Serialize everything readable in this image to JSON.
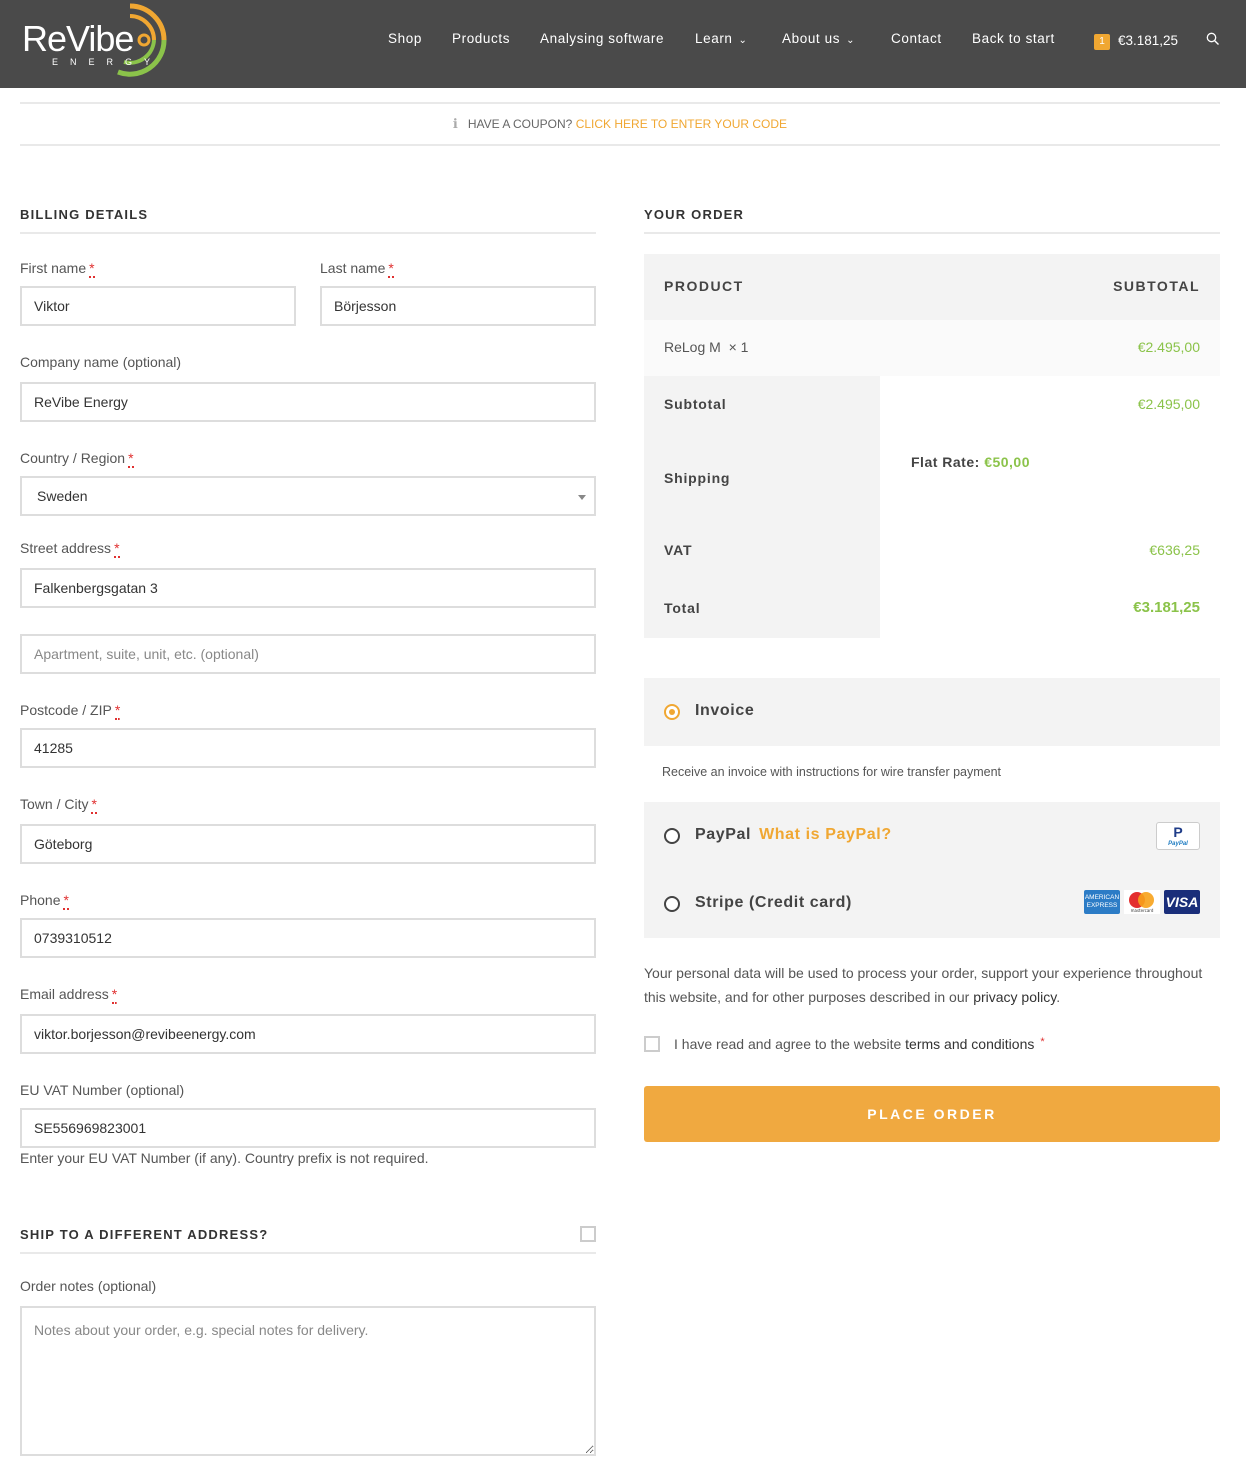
{
  "header": {
    "logo_text": "ReVibe",
    "logo_sub": "ENERGY",
    "nav": [
      "Shop",
      "Products",
      "Analysing software",
      "Learn",
      "About us",
      "Contact",
      "Back to start"
    ],
    "cart_count": "1",
    "cart_total": "€3.181,25"
  },
  "coupon": {
    "text": "Have a coupon?",
    "link": "Click here to enter your code"
  },
  "billing": {
    "title": "Billing details",
    "first_name_label": "First name",
    "first_name": "Viktor",
    "last_name_label": "Last name",
    "last_name": "Börjesson",
    "company_label": "Company name (optional)",
    "company": "ReVibe Energy",
    "country_label": "Country / Region",
    "country": "Sweden",
    "street_label": "Street address",
    "street": "Falkenbergsgatan 3",
    "apartment_placeholder": "Apartment, suite, unit, etc. (optional)",
    "postcode_label": "Postcode / ZIP",
    "postcode": "41285",
    "city_label": "Town / City",
    "city": "Göteborg",
    "phone_label": "Phone",
    "phone": "0739310512",
    "email_label": "Email address",
    "email": "viktor.borjesson@revibeenergy.com",
    "vat_label": "EU VAT Number (optional)",
    "vat": "SE556969823001",
    "vat_hint": "Enter your EU VAT Number (if any). Country prefix is not required.",
    "required_mark": "*"
  },
  "shipping": {
    "title": "Ship to a different address?",
    "notes_label": "Order notes (optional)",
    "notes_placeholder": "Notes about your order, e.g. special notes for delivery."
  },
  "order": {
    "title": "Your order",
    "col_product": "PRODUCT",
    "col_subtotal": "SUBTOTAL",
    "item_name": "ReLog M",
    "item_qty": "× 1",
    "item_price": "€2.495,00",
    "subtotal_label": "Subtotal",
    "subtotal": "€2.495,00",
    "shipping_label": "Shipping",
    "flat_rate_label": "Flat Rate:",
    "flat_rate": "€50,00",
    "vat_label": "VAT",
    "vat": "€636,25",
    "total_label": "Total",
    "total": "€3.181,25"
  },
  "payment": {
    "invoice_label": "Invoice",
    "invoice_desc": "Receive an invoice with instructions for wire transfer payment",
    "paypal_label": "PayPal",
    "paypal_link": "What is PayPal?",
    "paypal_badge": "P",
    "paypal_badge_sub": "PayPal",
    "stripe_label": "Stripe (Credit card)",
    "amex_text": "AMERICAN EXPRESS",
    "mc_text": "mastercard",
    "visa_text": "VISA"
  },
  "privacy": {
    "text": "Your personal data will be used to process your order, support your experience throughout this website, and for other purposes described in our ",
    "link": "privacy policy",
    "end": "."
  },
  "terms": {
    "text": "I have read and agree to the website ",
    "link": "terms and conditions",
    "star": "*"
  },
  "place_order": "Place order",
  "colors": {
    "accent": "#f0a732",
    "price_green": "#8bc34a",
    "header_bg": "#4a4a4a"
  }
}
